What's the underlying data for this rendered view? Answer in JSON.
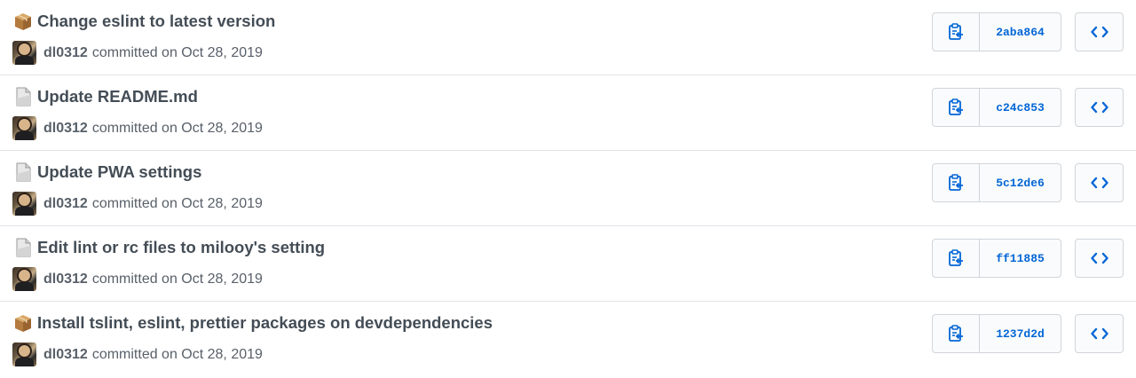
{
  "commits": [
    {
      "title": "Change eslint to latest version",
      "icon": "package-icon",
      "author": "dl0312",
      "date_text": "committed on Oct 28, 2019",
      "sha": "2aba864"
    },
    {
      "title": "Update README.md",
      "icon": "page-icon",
      "author": "dl0312",
      "date_text": "committed on Oct 28, 2019",
      "sha": "c24c853"
    },
    {
      "title": "Update PWA settings",
      "icon": "page-icon",
      "author": "dl0312",
      "date_text": "committed on Oct 28, 2019",
      "sha": "5c12de6"
    },
    {
      "title": "Edit lint or rc files to milooy's setting",
      "icon": "page-icon",
      "author": "dl0312",
      "date_text": "committed on Oct 28, 2019",
      "sha": "ff11885"
    },
    {
      "title": "Install tslint, eslint, prettier packages on devdependencies",
      "icon": "package-icon",
      "author": "dl0312",
      "date_text": "committed on Oct 28, 2019",
      "sha": "1237d2d"
    }
  ],
  "colors": {
    "accent": "#0366d6",
    "border": "#d1d5da",
    "muted": "#586069",
    "button_bg": "#fafbfc"
  }
}
